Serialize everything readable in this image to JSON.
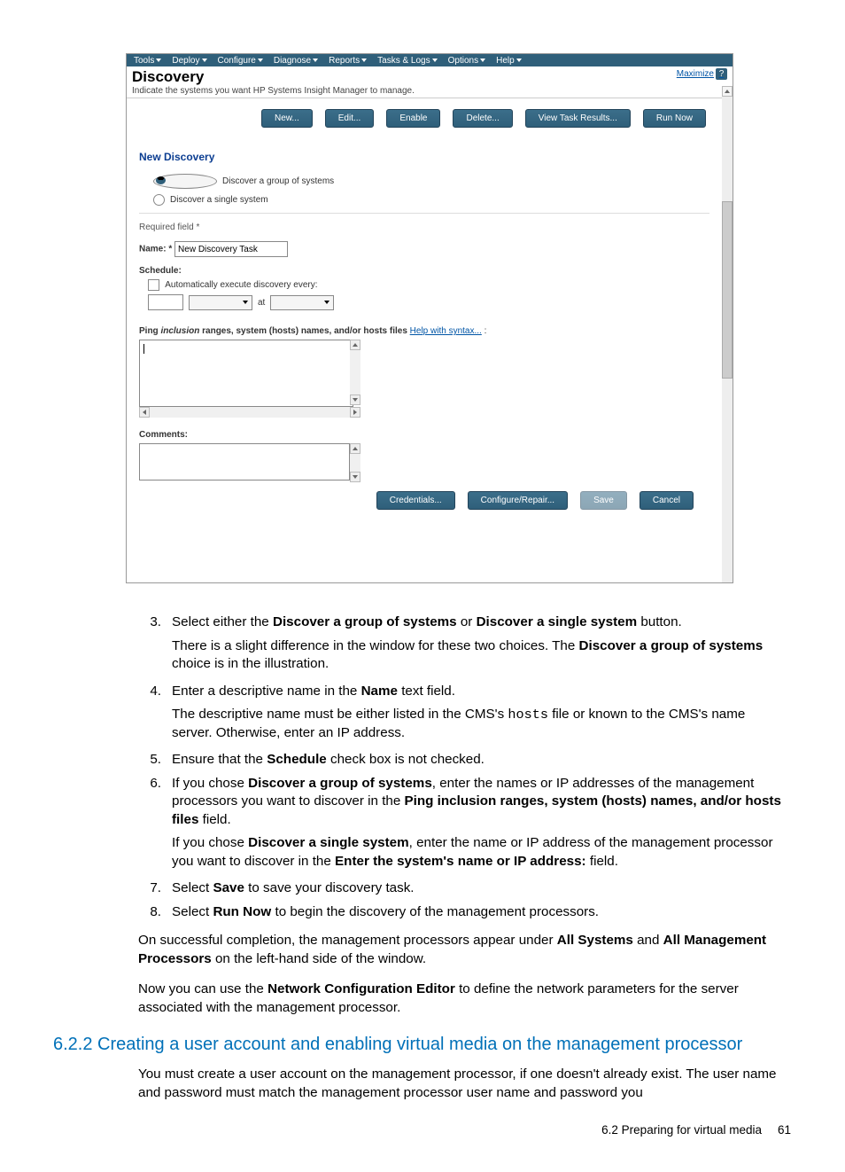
{
  "menubar": {
    "items": [
      "Tools",
      "Deploy",
      "Configure",
      "Diagnose",
      "Reports",
      "Tasks & Logs",
      "Options",
      "Help"
    ]
  },
  "header": {
    "title": "Discovery",
    "subtitle": "Indicate the systems you want HP Systems Insight Manager to manage.",
    "maximize": "Maximize",
    "help": "?"
  },
  "topButtons": {
    "new": "New...",
    "edit": "Edit...",
    "enable": "Enable",
    "delete": "Delete...",
    "viewResults": "View Task Results...",
    "runNow": "Run Now"
  },
  "section": "New Discovery",
  "radios": {
    "group": "Discover a group of systems",
    "single": "Discover a single system"
  },
  "form": {
    "required": "Required field *",
    "nameLabel": "Name: *",
    "nameValue": "New Discovery Task",
    "scheduleLabel": "Schedule:",
    "autoLabel": "Automatically execute discovery every:",
    "at": "at",
    "pingLabelA": "Ping ",
    "pingLabelItalic": "inclusion",
    "pingLabelB": " ranges, system (hosts) names, and/or hosts files  ",
    "helpLink": "Help with syntax...",
    "pingColon": " :",
    "commentsLabel": "Comments:"
  },
  "bottomButtons": {
    "credentials": "Credentials...",
    "configure": "Configure/Repair...",
    "save": "Save",
    "cancel": "Cancel"
  },
  "steps": {
    "s3": {
      "num": "3.",
      "textA": "Select either the ",
      "b1": "Discover a group of systems",
      "mid": " or ",
      "b2": "Discover a single system",
      "textB": " button.",
      "p": "There is a slight difference in the window for these two choices. The ",
      "pb": "Discover a group of systems",
      "p2": " choice is in the illustration."
    },
    "s4": {
      "num": "4.",
      "textA": "Enter a descriptive name in the ",
      "b1": "Name",
      "textB": " text field.",
      "p": "The descriptive name must be either listed in the CMS's ",
      "mono": "hosts",
      "p2": " file or known to the CMS's name server. Otherwise, enter an IP address."
    },
    "s5": {
      "num": "5.",
      "textA": "Ensure that the ",
      "b1": "Schedule",
      "textB": " check box is not checked."
    },
    "s6": {
      "num": "6.",
      "textA": "If you chose ",
      "b1": "Discover a group of systems",
      "textB": ", enter the names or IP addresses of the management processors you want to discover in the ",
      "b2": "Ping inclusion ranges, system (hosts) names, and/or hosts files",
      "textC": " field.",
      "p": "If you chose ",
      "pb": "Discover a single system",
      "p2": ", enter the name or IP address of the management processor you want to discover in the ",
      "pb2": "Enter the system's name or IP address:",
      "p3": " field."
    },
    "s7": {
      "num": "7.",
      "textA": "Select ",
      "b1": "Save",
      "textB": " to save your discovery task."
    },
    "s8": {
      "num": "8.",
      "textA": "Select ",
      "b1": "Run Now",
      "textB": " to begin the discovery of the management processors."
    }
  },
  "paras": {
    "a1": "On successful completion, the management processors appear under ",
    "ab1": "All Systems",
    "a2": " and ",
    "ab2": "All Management Processors",
    "a3": " on the left-hand side of the window.",
    "b1": "Now you can use the ",
    "bb": "Network Configuration Editor",
    "b2": " to define the network parameters for the server associated with the management processor."
  },
  "heading": "6.2.2 Creating a user account and enabling virtual media on the management processor",
  "body2": "You must create a user account on the management processor, if one doesn't already exist. The user name and password must match the management processor user name and password you",
  "footer": {
    "label": "6.2 Preparing for virtual media",
    "page": "61"
  }
}
